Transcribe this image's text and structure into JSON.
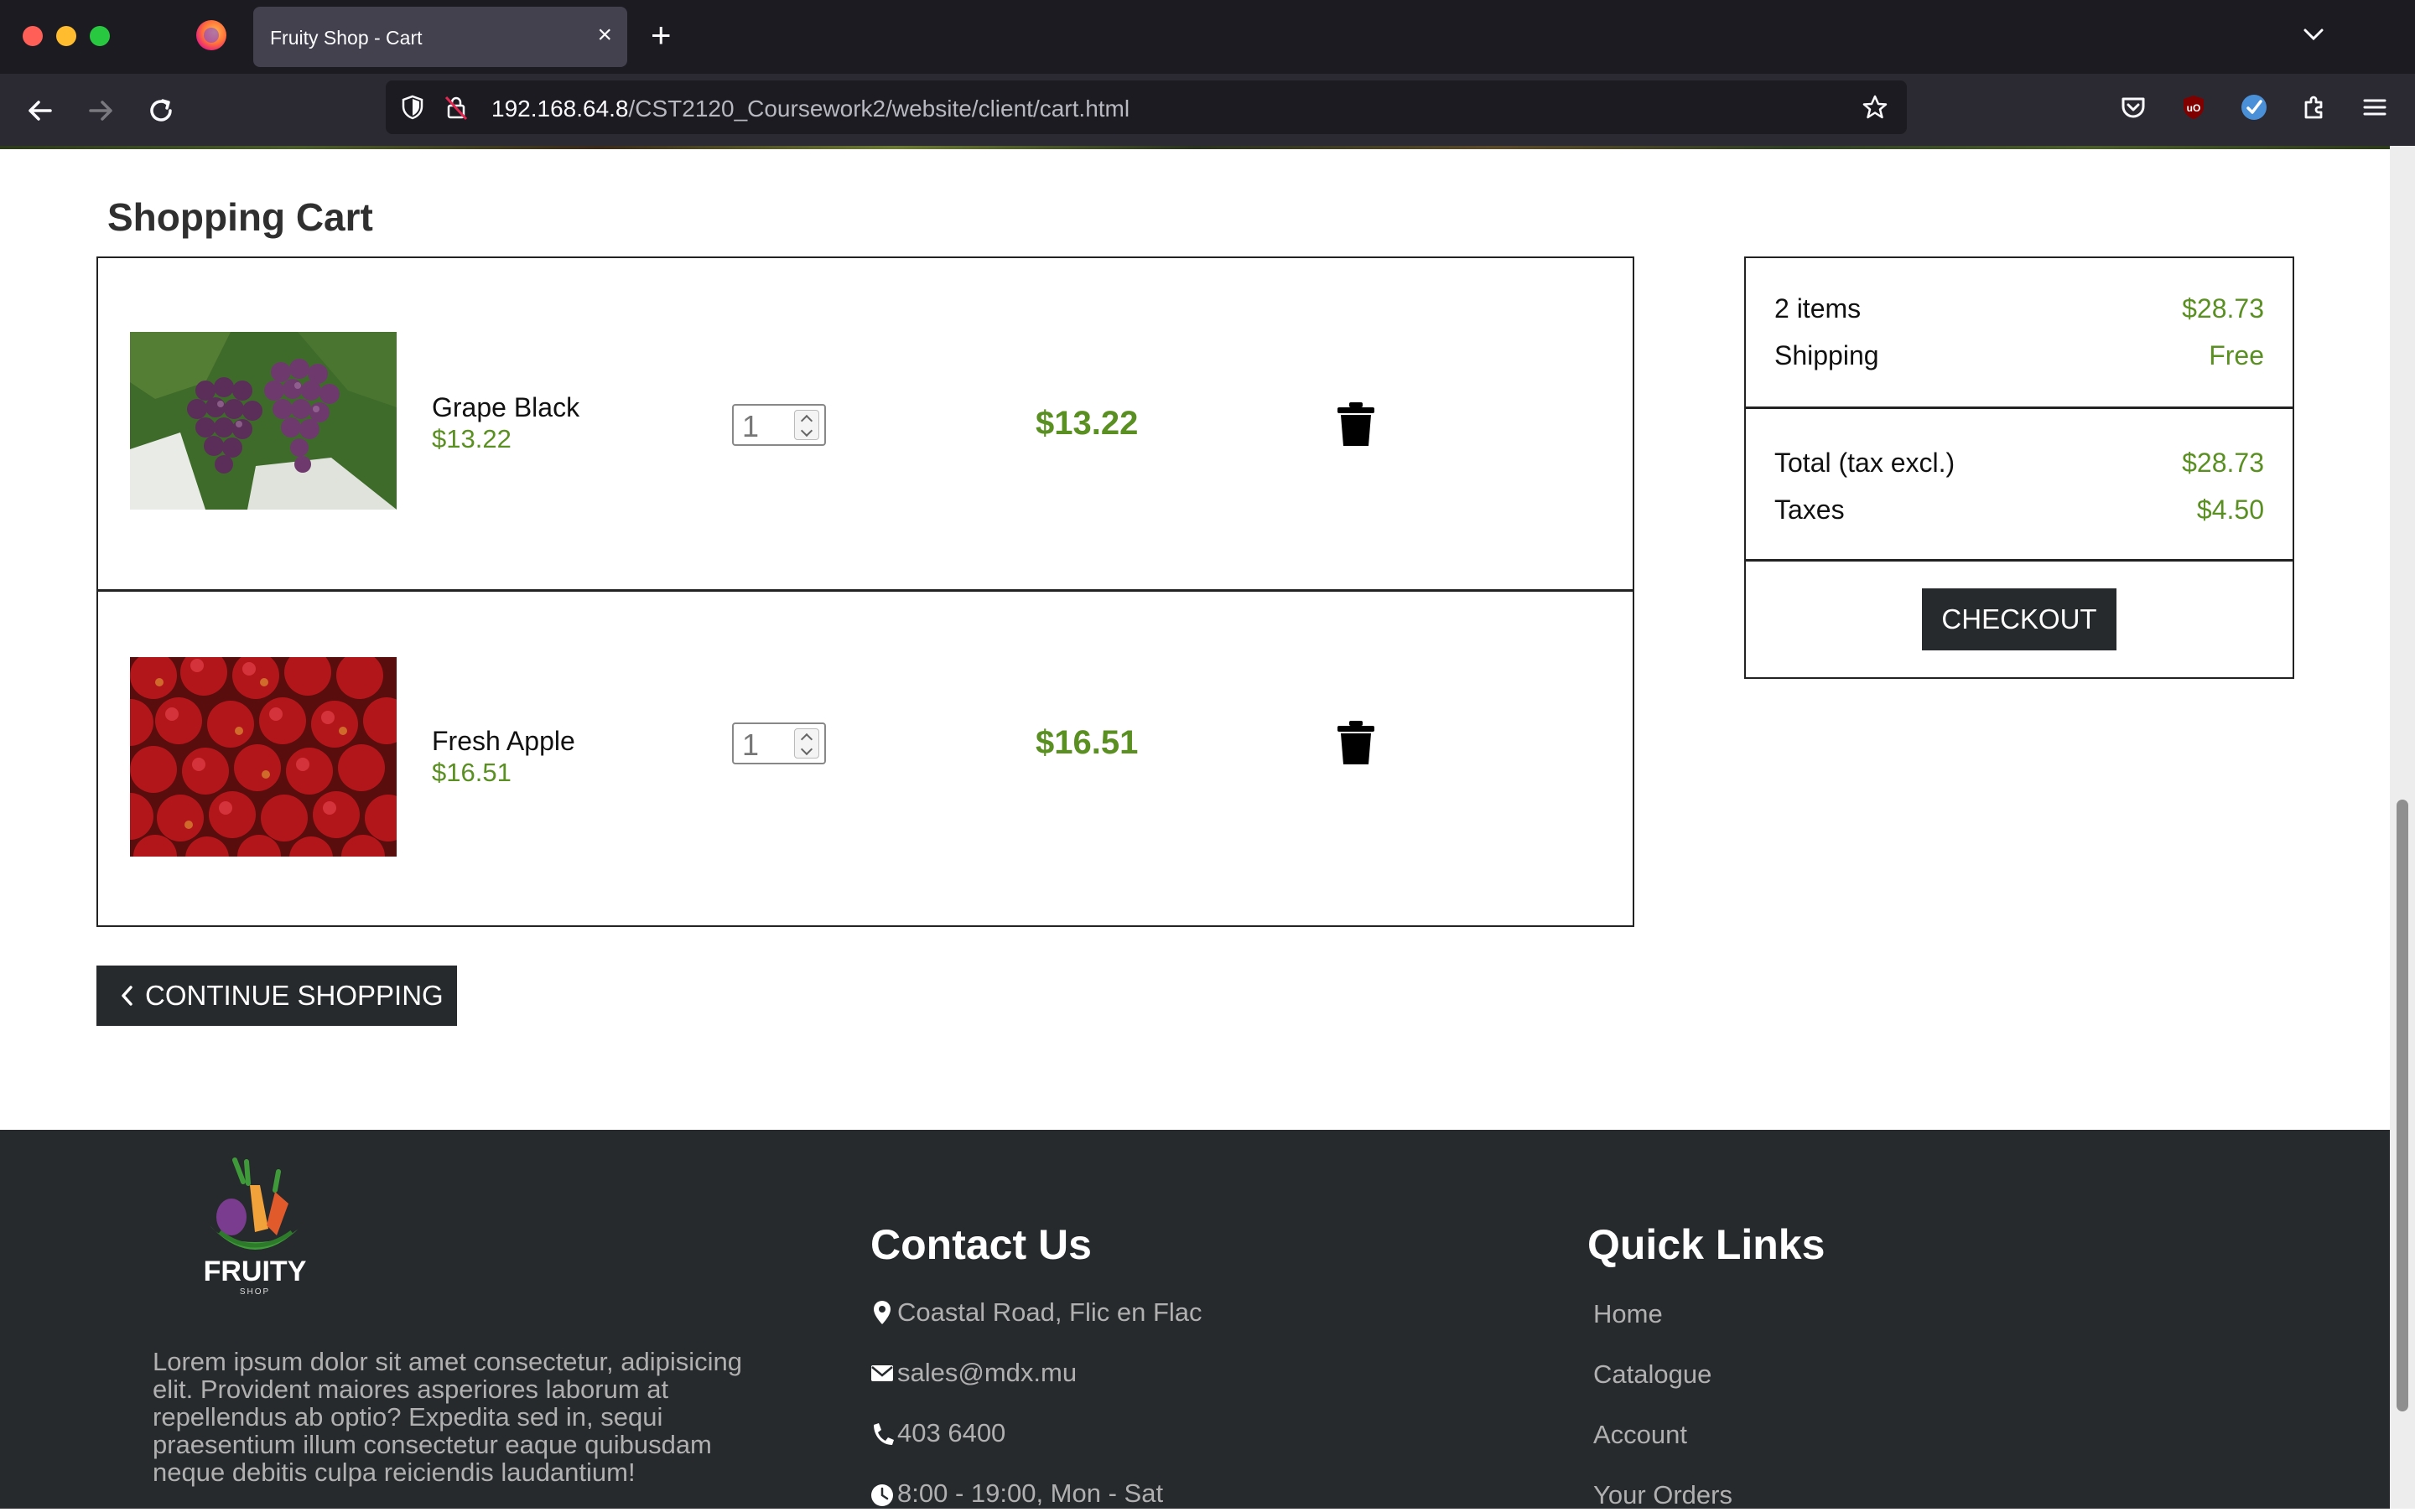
{
  "browser": {
    "tab_title": "Fruity Shop - Cart",
    "url_host": "192.168.64.8",
    "url_path": "/CST2120_Coursework2/website/client/cart.html"
  },
  "page": {
    "title": "Shopping Cart"
  },
  "cart": {
    "items": [
      {
        "name": "Grape Black",
        "unit_price": "$13.22",
        "quantity": "1",
        "line_total": "$13.22",
        "image": "grapes-image"
      },
      {
        "name": "Fresh Apple",
        "unit_price": "$16.51",
        "quantity": "1",
        "line_total": "$16.51",
        "image": "apples-image"
      }
    ]
  },
  "summary": {
    "items_label": "2 items",
    "items_value": "$28.73",
    "shipping_label": "Shipping",
    "shipping_value": "Free",
    "total_label": "Total (tax excl.)",
    "total_value": "$28.73",
    "taxes_label": "Taxes",
    "taxes_value": "$4.50",
    "checkout_label": "CHECKOUT"
  },
  "continue_label": "CONTINUE SHOPPING",
  "footer": {
    "brand": "FRUITY",
    "brand_sub": "SHOP",
    "about": "Lorem ipsum dolor sit amet consectetur, adipisicing elit. Provident maiores asperiores laborum at repellendus ab optio? Expedita sed in, sequi praesentium illum consectetur eaque quibusdam neque debitis culpa reiciendis laudantium!",
    "contact_title": "Contact Us",
    "address": "Coastal Road, Flic en Flac",
    "email": "sales@mdx.mu",
    "phone": "403 6400",
    "hours": "8:00 - 19:00, Mon - Sat",
    "links_title": "Quick Links",
    "links": [
      "Home",
      "Catalogue",
      "Account",
      "Your Orders"
    ]
  },
  "colors": {
    "accent_green": "#5a8f22",
    "dark": "#262a2d"
  }
}
